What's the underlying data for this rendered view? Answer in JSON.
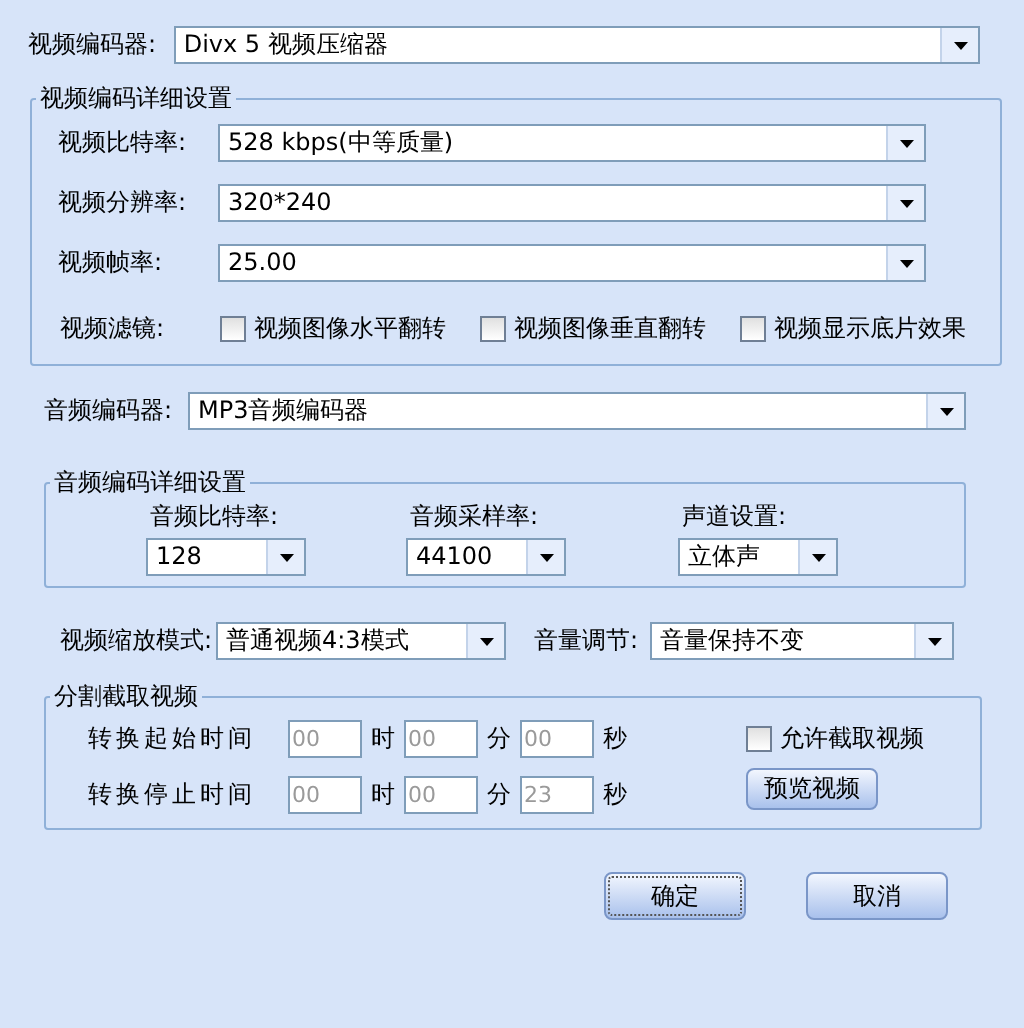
{
  "video_encoder": {
    "label": "视频编码器:",
    "value": "Divx 5 视频压缩器"
  },
  "video_settings": {
    "title": "视频编码详细设置",
    "fields": [
      {
        "label": "视频比特率:",
        "value": "528 kbps(中等质量)"
      },
      {
        "label": "视频分辨率:",
        "value": "320*240"
      },
      {
        "label": "视频帧率:",
        "value": "25.00"
      }
    ],
    "filter": {
      "label": "视频滤镜:",
      "options": [
        {
          "label": "视频图像水平翻转",
          "checked": false
        },
        {
          "label": "视频图像垂直翻转",
          "checked": false
        },
        {
          "label": "视频显示底片效果",
          "checked": false
        }
      ]
    }
  },
  "audio_encoder": {
    "label": "音频编码器:",
    "value": "MP3音频编码器"
  },
  "audio_settings": {
    "title": "音频编码详细设置",
    "fields": [
      {
        "label": "音频比特率:",
        "value": "128"
      },
      {
        "label": "音频采样率:",
        "value": "44100"
      },
      {
        "label": "声道设置:",
        "value": "立体声"
      }
    ]
  },
  "scale_mode": {
    "label": "视频缩放模式:",
    "value": "普通视频4:3模式"
  },
  "volume": {
    "label": "音量调节:",
    "value": "音量保持不变"
  },
  "split": {
    "title": "分割截取视频",
    "disabled": true,
    "rows": [
      {
        "label": "转换起始时间",
        "fields": [
          {
            "value": "00",
            "unit": "时"
          },
          {
            "value": "00",
            "unit": "分"
          },
          {
            "value": "00",
            "unit": "秒"
          }
        ]
      },
      {
        "label": "转换停止时间",
        "fields": [
          {
            "value": "00",
            "unit": "时"
          },
          {
            "value": "00",
            "unit": "分"
          },
          {
            "value": "23",
            "unit": "秒"
          }
        ]
      }
    ],
    "allow": {
      "label": "允许截取视频",
      "checked": false
    },
    "preview_button": "预览视频"
  },
  "buttons": [
    {
      "label": "确定",
      "focused": true
    },
    {
      "label": "取消",
      "focused": false
    }
  ]
}
